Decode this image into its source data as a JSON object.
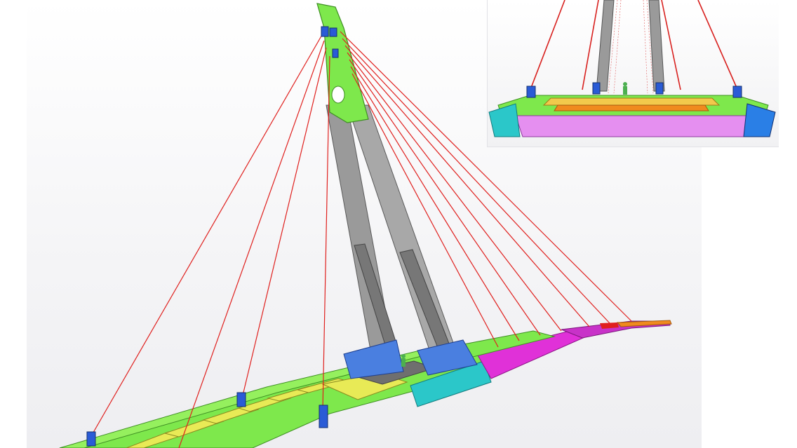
{
  "image": {
    "subject": "cable-stayed-footbridge-3d-model",
    "colors": {
      "pylon_top": "#7ee84c",
      "pylon_legs": "#9a9a9a",
      "deck_green": "#7ee84c",
      "deck_yellow": "#e8ea56",
      "deck_teal": "#2bc7c9",
      "deck_magenta": "#e031d8",
      "deck_orange": "#f08a1e",
      "cables": "#e0201e",
      "anchors": "#2a5bd6",
      "inset_box": "#e58ff0"
    }
  }
}
